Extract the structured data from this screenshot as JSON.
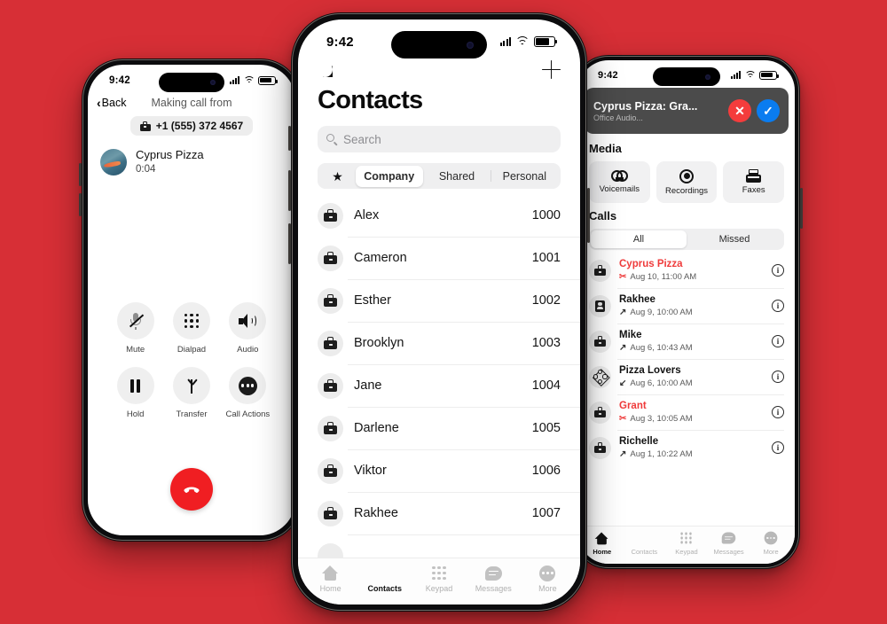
{
  "background_color": "#d72f36",
  "phone_left": {
    "status": {
      "time": "9:42"
    },
    "nav": {
      "back_label": "Back",
      "title": "Making call from"
    },
    "from_pill": {
      "icon": "briefcase-icon",
      "number": "+1 (555) 372 4567"
    },
    "caller": {
      "name": "Cyprus Pizza",
      "timer": "0:04"
    },
    "controls": [
      {
        "label": "Mute",
        "icon": "mic-muted-icon"
      },
      {
        "label": "Dialpad",
        "icon": "dialpad-icon"
      },
      {
        "label": "Audio",
        "icon": "speaker-icon"
      },
      {
        "label": "Hold",
        "icon": "pause-icon"
      },
      {
        "label": "Transfer",
        "icon": "arrow-up-icon"
      },
      {
        "label": "Call Actions",
        "icon": "ellipsis-circle-icon"
      }
    ],
    "end_call": {
      "icon": "hang-up-icon",
      "color": "#f01e22"
    }
  },
  "phone_center": {
    "status": {
      "time": "9:42"
    },
    "top": {
      "left_icon": "moon-icon",
      "right_icon": "plus-icon"
    },
    "title": "Contacts",
    "search": {
      "placeholder": "Search",
      "icon": "search-icon"
    },
    "segments": {
      "star_icon": "star-icon",
      "items": [
        {
          "label": "Company",
          "active": true
        },
        {
          "label": "Shared",
          "active": false
        },
        {
          "label": "Personal",
          "active": false
        }
      ]
    },
    "contacts": [
      {
        "name": "Alex",
        "ext": "1000",
        "icon": "briefcase-icon"
      },
      {
        "name": "Cameron",
        "ext": "1001",
        "icon": "briefcase-icon"
      },
      {
        "name": "Esther",
        "ext": "1002",
        "icon": "briefcase-icon"
      },
      {
        "name": "Brooklyn",
        "ext": "1003",
        "icon": "briefcase-icon"
      },
      {
        "name": "Jane",
        "ext": "1004",
        "icon": "briefcase-icon"
      },
      {
        "name": "Darlene",
        "ext": "1005",
        "icon": "briefcase-icon"
      },
      {
        "name": "Viktor",
        "ext": "1006",
        "icon": "briefcase-icon"
      },
      {
        "name": "Rakhee",
        "ext": "1007",
        "icon": "briefcase-icon"
      }
    ],
    "tabs": [
      {
        "label": "Home",
        "icon": "home-icon",
        "active": false
      },
      {
        "label": "Contacts",
        "icon": "people-icon",
        "active": true
      },
      {
        "label": "Keypad",
        "icon": "keypad-icon",
        "active": false
      },
      {
        "label": "Messages",
        "icon": "message-icon",
        "active": false
      },
      {
        "label": "More",
        "icon": "more-icon",
        "active": false
      }
    ]
  },
  "phone_right": {
    "status": {
      "time": "9:42"
    },
    "banner": {
      "title": "Cyprus Pizza: Gra...",
      "subtitle": "Office Audio...",
      "decline_icon": "close-icon",
      "accept_icon": "check-icon",
      "decline_color": "#f43c3c",
      "accept_color": "#0a7cf0"
    },
    "media": {
      "title": "Media",
      "items": [
        {
          "label": "Voicemails",
          "icon": "voicemail-icon"
        },
        {
          "label": "Recordings",
          "icon": "record-icon"
        },
        {
          "label": "Faxes",
          "icon": "fax-icon"
        }
      ]
    },
    "calls": {
      "title": "Calls",
      "filters": [
        {
          "label": "All",
          "active": true
        },
        {
          "label": "Missed",
          "active": false
        }
      ],
      "items": [
        {
          "name": "Cyprus Pizza",
          "time": "Aug 10, 11:00 AM",
          "direction": "missed",
          "dir_glyph": "✂",
          "missed": true,
          "icon": "briefcase-icon",
          "info_icon": "info-icon"
        },
        {
          "name": "Rakhee",
          "time": "Aug 9, 10:00 AM",
          "direction": "outgoing",
          "dir_glyph": "↗",
          "missed": false,
          "icon": "contact-card-icon",
          "info_icon": "info-icon"
        },
        {
          "name": "Mike",
          "time": "Aug 6, 10:43 AM",
          "direction": "outgoing",
          "dir_glyph": "↗",
          "missed": false,
          "icon": "briefcase-icon",
          "info_icon": "info-icon"
        },
        {
          "name": "Pizza Lovers",
          "time": "Aug 6, 10:00 AM",
          "direction": "incoming",
          "dir_glyph": "↙",
          "missed": false,
          "icon": "group-icon",
          "info_icon": "info-icon"
        },
        {
          "name": "Grant",
          "time": "Aug 3, 10:05 AM",
          "direction": "missed",
          "dir_glyph": "✂",
          "missed": true,
          "icon": "briefcase-icon",
          "info_icon": "info-icon"
        },
        {
          "name": "Richelle",
          "time": "Aug 1, 10:22 AM",
          "direction": "outgoing",
          "dir_glyph": "↗",
          "missed": false,
          "icon": "briefcase-icon",
          "info_icon": "info-icon"
        }
      ]
    },
    "tabs": [
      {
        "label": "Home",
        "icon": "home-icon",
        "active": true
      },
      {
        "label": "Contacts",
        "icon": "people-icon",
        "active": false
      },
      {
        "label": "Keypad",
        "icon": "keypad-icon",
        "active": false
      },
      {
        "label": "Messages",
        "icon": "message-icon",
        "active": false
      },
      {
        "label": "More",
        "icon": "more-icon",
        "active": false
      }
    ]
  }
}
